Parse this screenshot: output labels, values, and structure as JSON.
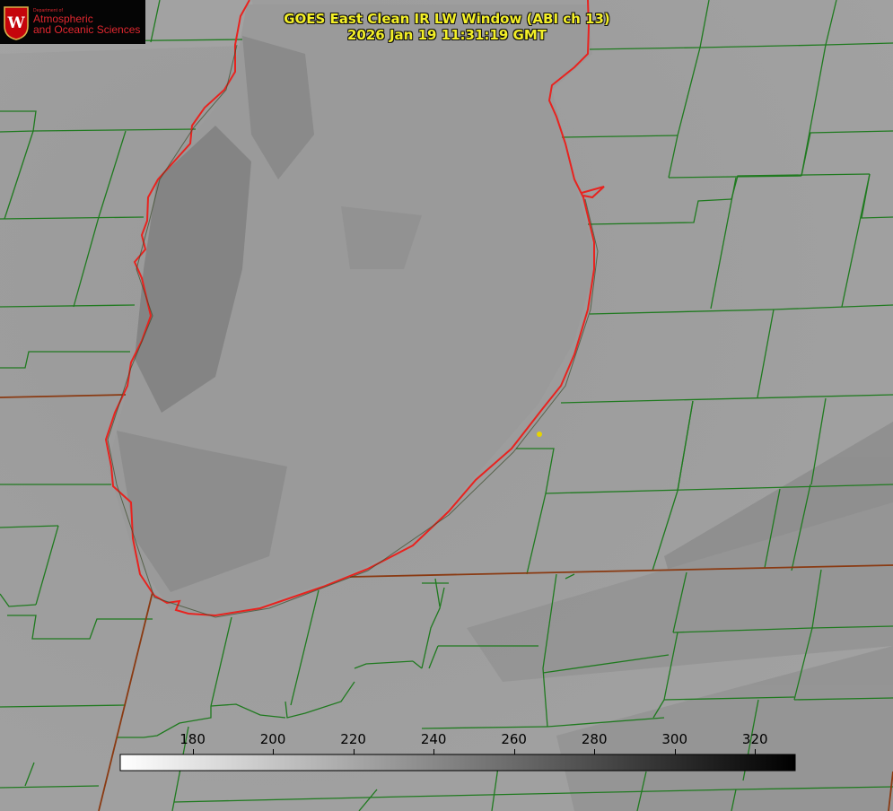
{
  "title": {
    "line1": "GOES East Clean IR LW Window (ABI ch 13)",
    "line2": "2026 Jan 19 11:31:19 GMT"
  },
  "logo": {
    "department": "Department of",
    "line1": "Atmospheric",
    "line2": "and Oceanic Sciences",
    "seal_letter": "W"
  },
  "colors": {
    "background_gray": "#9e9e9e",
    "lake_shoreline": "#e8231f",
    "county_lines": "#1f7a1f",
    "state_lines": "#8a3a12",
    "title_text": "#f3ef28",
    "logo_red": "#e0272f",
    "station_dot": "#e6d400"
  },
  "colorbar": {
    "min": 162,
    "max": 330,
    "ticks": [
      180,
      200,
      220,
      240,
      260,
      280,
      300,
      320
    ],
    "tick_labels": [
      "180",
      "200",
      "220",
      "240",
      "260",
      "280",
      "300",
      "320"
    ],
    "gradient": [
      "#ffffff",
      "#000000"
    ]
  }
}
